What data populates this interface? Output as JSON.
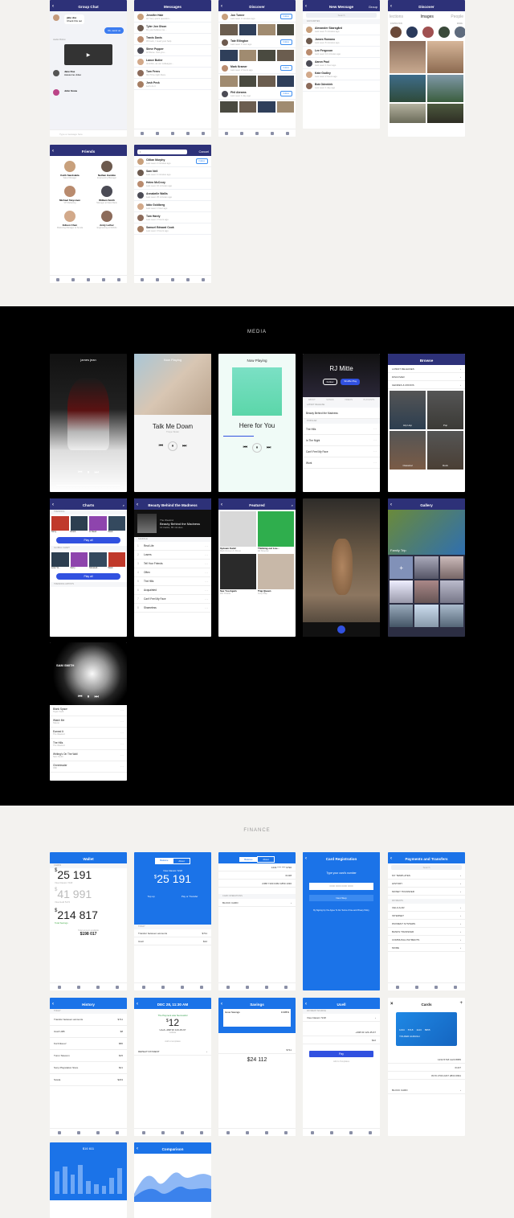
{
  "sections": {
    "media": "MEDIA",
    "finance": "FINANCE"
  },
  "colors": {
    "navy": "#2d3178",
    "blue": "#1b73e8",
    "accent": "#3151e0"
  },
  "social": {
    "group_chat": {
      "title": "Group Chat",
      "input_placeholder": "Type a message here",
      "msg1_name": "jabe doe",
      "msg1_text": "Check this out",
      "msg2": "Ok, send us",
      "msg3_name": "Hadler Bolton",
      "msg4_name": "Jane Doe",
      "msg4_text": "Awesome video",
      "msg5_name": "John Snow"
    },
    "messages": {
      "title": "Messages",
      "items": [
        {
          "name": "Jennifer Hale",
          "sub": "Hi! Very quick question..."
        },
        {
          "name": "Tyler Jon Olson",
          "sub": "Do you believe me..."
        },
        {
          "name": "Travis Davis",
          "sub": "Oh look, I need your help"
        },
        {
          "name": "Steve Popper",
          "sub": "Hi Steve. Can you..."
        },
        {
          "name": "Lance Butler",
          "sub": "Jennifer, as our colleague..."
        },
        {
          "name": "Tom Ferns",
          "sub": "Ok I'll be right there"
        },
        {
          "name": "Josh Peck",
          "sub": "Let's do it"
        }
      ]
    },
    "discover_people": {
      "title": "Discover",
      "subtitle": "People",
      "follow": "Follow",
      "people": [
        {
          "name": "Jon Turner",
          "sub": "Last seen 3 minutes ago"
        },
        {
          "name": "Tate Ellington",
          "sub": "Last seen 1 hour ago"
        },
        {
          "name": "Mark Kramer",
          "sub": "Last seen 2 hours ago"
        },
        {
          "name": "Phil Abrams",
          "sub": "Last seen 1 day ago"
        }
      ]
    },
    "new_message": {
      "title": "New Message",
      "right": "Group",
      "search": "Search",
      "favourites": "FAVOURITES",
      "contacts": [
        {
          "name": "Alexander Skarsgård",
          "sub": "Last seen 5 minutes ago"
        },
        {
          "name": "James Romano",
          "sub": "Last seen 8 minutes ago"
        },
        {
          "name": "Lee Ferguson",
          "sub": "Last seen 12 minutes ago"
        },
        {
          "name": "Aaron Paul",
          "sub": "Last seen 1 hour ago"
        },
        {
          "name": "Kate Godley",
          "sub": "Last seen 2 hours ago"
        },
        {
          "name": "Bob Odenkirk",
          "sub": "Last seen 1 day ago"
        }
      ]
    },
    "discover_images": {
      "title": "Discover",
      "tabs": [
        "lections",
        "Images",
        "People"
      ],
      "inspiration": "INSPIRATION",
      "more": "MORE"
    },
    "friends": {
      "title": "Friends",
      "people": [
        {
          "name": "Keith Sandvakla",
          "role": "Sales Manager"
        },
        {
          "name": "Nathan Gamble",
          "role": "Engineering Manager"
        },
        {
          "name": "Michael Steysmen",
          "role": "VP Marketing"
        },
        {
          "name": "William Smith",
          "role": "Manager at Stark Bank"
        },
        {
          "name": "Edison Chen",
          "role": "Marketing Manager at Senda"
        },
        {
          "name": "Andy Luther",
          "role": "Engineering at Mobilio"
        }
      ]
    },
    "search_people": {
      "query": "l",
      "cancel": "Cancel",
      "follow": "Follow",
      "people": [
        {
          "name": "Cillian Murphy",
          "sub": "Last seen 2 minutes ago"
        },
        {
          "name": "Sam Neil",
          "sub": "Last seen 4 minutes ago"
        },
        {
          "name": "Helen McCrory",
          "sub": "Last seen 10 minutes ago"
        },
        {
          "name": "Annabelle Wallis",
          "sub": "Last seen 25 minutes ago"
        },
        {
          "name": "Iddo Goldberg",
          "sub": "Last seen 1 hour ago"
        },
        {
          "name": "Tom Hardy",
          "sub": "Last seen 2 hours ago"
        },
        {
          "name": "Samuel Edward Cook",
          "sub": "Last seen 3 hours ago"
        }
      ]
    }
  },
  "media": {
    "player_dark": {
      "artist": "james jean"
    },
    "player_art": {
      "title": "Now Playing",
      "song": "Talk Me Down",
      "artist": "Troye Sivan"
    },
    "player_light": {
      "title": "Now Playing",
      "song": "Here for You"
    },
    "artist": {
      "name": "RJ Mitte",
      "follow": "Follow",
      "shuffle": "Shuffle Play",
      "tabs": [
        "ABOUT",
        "SONGS",
        "VIDEOS",
        "PLAYLISTS"
      ],
      "latest": "LATEST RELEASE",
      "album": "Beauty Behind the Madness",
      "popular": "POPULAR",
      "songs": [
        "The Hills",
        "In The Night",
        "Can't Feel My Face",
        "Work"
      ]
    },
    "browse": {
      "title": "Browse",
      "items": [
        "LATEST RELEASES",
        "DISCOVER",
        "GENRES & MOODS"
      ],
      "genres": [
        "Hip Hop",
        "Pop",
        "Classical",
        "Rock"
      ]
    },
    "charts": {
      "title": "Charts",
      "trending": "TRENDING",
      "play_all": "Play all",
      "global": "GLOBAL CHART",
      "trending_artists": "TRENDING ARTISTS",
      "row1": [
        "Sorry",
        "Drunk",
        "In Need",
        "Work"
      ],
      "row2": [
        "Love Yo...",
        "Sorry",
        "Stressed...",
        "Work"
      ]
    },
    "album": {
      "title": "Beauty Behind the Madness",
      "artist": "The Weeknd",
      "meta": "14 tracks, 65 minutes",
      "shuffle": "SHUFFLE",
      "tracks": [
        "Real Life",
        "Losers",
        "Tell Your Friends",
        "Often",
        "The Hills",
        "Acquainted",
        "Can't Feel My Face",
        "Shameless"
      ]
    },
    "featured": {
      "title": "Featured",
      "items": [
        {
          "title": "Uptown Funk!",
          "sub": "Mark Ronson ft. Bruno"
        },
        {
          "title": "Thinking out Lou...",
          "sub": "Ed Sheeran"
        },
        {
          "title": "See You Again",
          "sub": "Wiz Khalifa"
        },
        {
          "title": "Trap Queen",
          "sub": "Fetty Wap"
        }
      ]
    },
    "gallery": {
      "title": "Gallery",
      "caption": "Family Trip"
    },
    "sam_smith": {
      "artist": "SAM SMITH",
      "tracks": [
        {
          "t": "Blank Space",
          "a": "Taylor Swift"
        },
        {
          "t": "Watch Me",
          "a": "Silento"
        },
        {
          "t": "Earned It",
          "a": "The Weeknd"
        },
        {
          "t": "The Hills",
          "a": "The Weeknd"
        },
        {
          "t": "Writing's On The Wall",
          "a": "Sam Smith"
        },
        {
          "t": "Cheerleader",
          "a": "OMI"
        }
      ]
    }
  },
  "finance": {
    "wallet": {
      "title": "Wallet",
      "cards": "CARDS",
      "v1": "25 191",
      "v1sub": "Visa Classic 7218",
      "v2": "41 991",
      "v2sub": "Visa Gold 5172",
      "v3": "214 817",
      "v3sub": "Total Savings",
      "total_label": "Total amount available",
      "total": "$198 017"
    },
    "balance": {
      "tabs": [
        "Balance",
        "About"
      ],
      "card": "Visa Classic 7218",
      "value": "25 191",
      "topup": "Top up",
      "pay": "Pay or Transfer",
      "today": "TODAY",
      "t1": "Transfer between accounts",
      "a1": "$711",
      "t2": "Ucell",
      "a2": "$12"
    },
    "about": {
      "tabs": [
        "Balance",
        "About"
      ],
      "number": "1234 **** **** 6790",
      "expiry": "01/28",
      "account": "2458 7100 0452 1859 1330",
      "blocked": "BLOCK CARD",
      "card_ops": "CARD OPERATIONS"
    },
    "card_reg": {
      "title": "Card Registration",
      "prompt": "Type your card's number",
      "placeholder": "0000 0000 0000 0000",
      "next": "Next Step",
      "terms": "By Signing Up You Agree To Our Terms of Use and Privacy Policy"
    },
    "payments": {
      "title": "Payments and Transfers",
      "search": "Search",
      "items": [
        "MY TEMPLATES",
        "HISTORY",
        "MONEY TRANSFER"
      ],
      "section": "PAYMENTS",
      "payments": [
        "CELLULAR",
        "INTERNET",
        "PAYMENT SYSTEMS",
        "BANKS TRANSFER",
        "COMMUNAL PAYMENTS",
        "MORE"
      ]
    },
    "history": {
      "title": "History",
      "today": "TODAY",
      "rows": [
        {
          "t": "Transfer between accounts",
          "a": "$711"
        },
        {
          "t": "Ucell UZB",
          "a": "$8"
        },
        {
          "t": "Korzinka.uz",
          "a": "$80"
        },
        {
          "t": "Turon Telecom",
          "a": "$15"
        },
        {
          "t": "Sony Playstation Store",
          "a": "$21"
        },
        {
          "t": "Sowta",
          "a": "$233"
        }
      ]
    },
    "receipt": {
      "date": "DEC 28, 11:30 AM",
      "status": "The Payment was Successful",
      "amount": "12",
      "name": "Ucell +998 93 123-45-67",
      "sub": "Cellular",
      "add": "Add to templates",
      "repeat": "REPEAT PAYMENT"
    },
    "savings": {
      "title": "Savings",
      "plan": "Grow Savings",
      "rate": "0.335%",
      "amount": "24 112",
      "total": "$711"
    },
    "ucell": {
      "title": "Ucell",
      "source": "PAYMENT SOURCE",
      "card": "Visa Classic 7218",
      "phone": "+998 93 123-45-67",
      "amount": "$12",
      "pay": "Pay",
      "add": "Add to Templates"
    },
    "cards": {
      "title": "Cards",
      "holder": "YOLDER ALMAGH",
      "digits": [
        "1234",
        "5718",
        "1123",
        "8955"
      ],
      "expiry": "01/27",
      "number": "1234 5718 1123 8955",
      "account": "8170 2700 2237 2834 0991",
      "blocked": "BLOCK CARD"
    },
    "chart": {
      "total": "$16 611"
    },
    "comparison": {
      "title": "Comparison"
    }
  }
}
